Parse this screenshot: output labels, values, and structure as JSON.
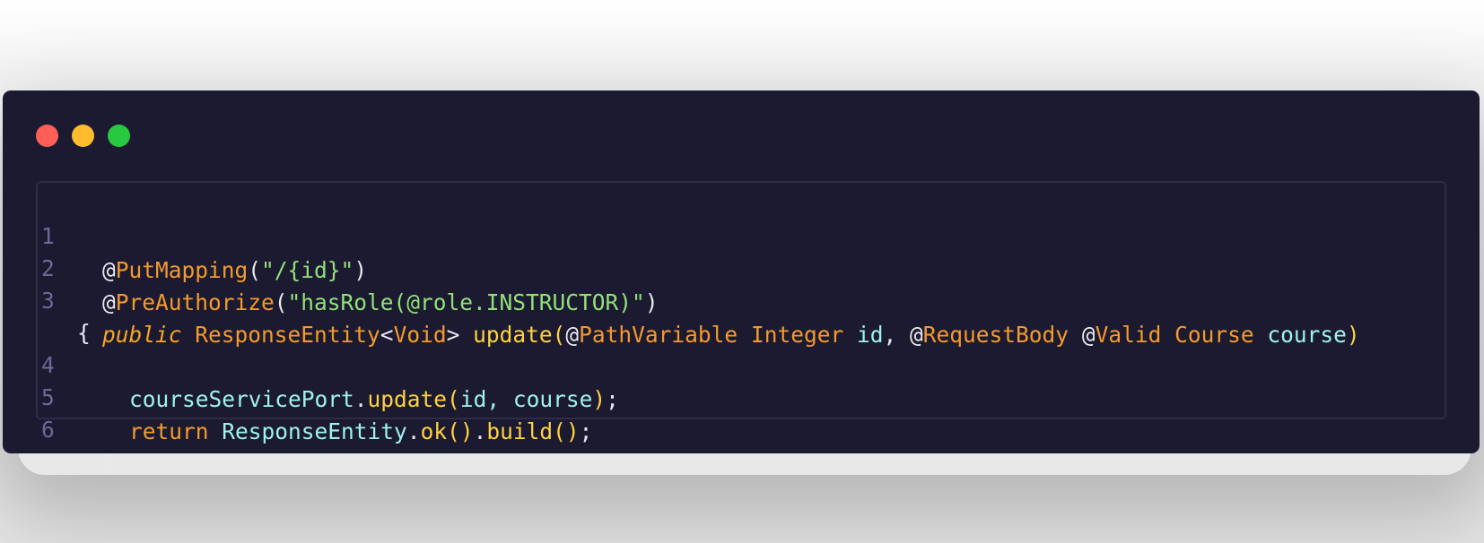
{
  "window": {
    "controls": [
      "close",
      "minimize",
      "maximize"
    ],
    "colors": {
      "close": "#ff5f57",
      "minimize": "#febc2e",
      "maximize": "#28c840",
      "background": "#1b1a30"
    }
  },
  "code": {
    "line_numbers": [
      "1",
      "2",
      "3",
      "4",
      "5",
      "6"
    ],
    "line1": {
      "at": "@",
      "anno": "PutMapping",
      "open": "(",
      "str": "\"/{id}\"",
      "close": ")"
    },
    "line2": {
      "at": "@",
      "anno": "PreAuthorize",
      "open": "(",
      "str": "\"hasRole(@role.INSTRUCTOR)\"",
      "close": ")"
    },
    "line3": {
      "public": "public",
      "type1": "ResponseEntity",
      "lt": "<",
      "type2": "Void",
      "gt": ">",
      "fn": "update",
      "open": "(",
      "at1": "@",
      "anno1": "PathVariable",
      "type3": "Integer",
      "var1": "id",
      "comma": ",",
      "at2": "@",
      "anno2": "RequestBody",
      "at3": "@",
      "anno3": "Valid",
      "type4": "Course",
      "var2": "course",
      "close": ")"
    },
    "line3_wrap": "{",
    "line4": {
      "obj": "courseServicePort",
      "dot": ".",
      "fn": "update",
      "open": "(",
      "args": "id, course",
      "close": ")",
      "semi": ";"
    },
    "line5": {
      "ret": "return",
      "obj": "ResponseEntity",
      "dot1": ".",
      "fn1": "ok",
      "p1": "()",
      "dot2": ".",
      "fn2": "build",
      "p2": "()",
      "semi": ";"
    },
    "line6": "}"
  }
}
